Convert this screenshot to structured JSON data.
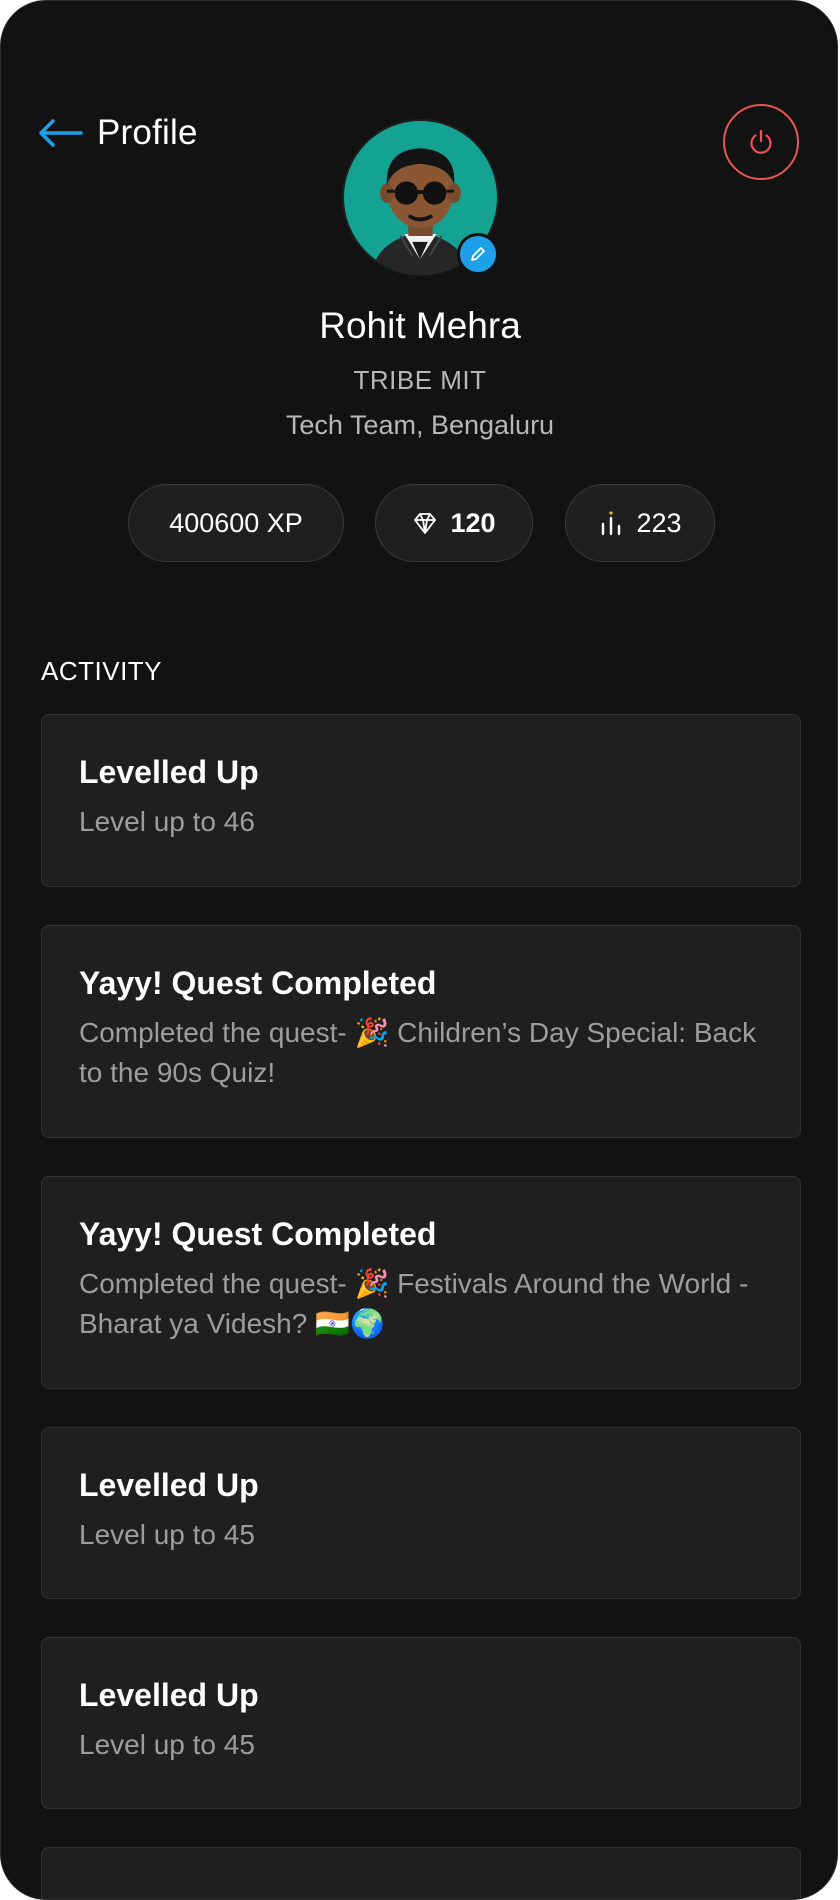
{
  "header": {
    "title": "Profile"
  },
  "profile": {
    "name": "Rohit Mehra",
    "tribe": "TRIBE MIT",
    "team": "Tech Team, Bengaluru"
  },
  "stats": {
    "xp": "400600 XP",
    "gems": "120",
    "rank": "223"
  },
  "activity": {
    "heading": "ACTIVITY",
    "items": [
      {
        "title": "Levelled Up",
        "desc": "Level up to 46"
      },
      {
        "title": "Yayy! Quest Completed",
        "desc": "Completed the quest- 🎉 Children’s Day Special: Back to the 90s Quiz!"
      },
      {
        "title": "Yayy! Quest Completed",
        "desc": "Completed the quest- 🎉 Festivals Around the World - Bharat ya Videsh? 🇮🇳🌍"
      },
      {
        "title": "Levelled Up",
        "desc": "Level up to 45"
      },
      {
        "title": "Levelled Up",
        "desc": "Level up to 45"
      }
    ]
  },
  "colors": {
    "background": "#121212",
    "card": "#1f1f1f",
    "accent_blue": "#1ea0e8",
    "logout_red": "#e85555",
    "avatar_bg": "#14a392"
  },
  "icons": {
    "back": "arrow-left-icon",
    "logout": "power-icon",
    "edit": "pencil-icon",
    "gems": "diamond-icon",
    "rank": "bar-chart-icon"
  }
}
